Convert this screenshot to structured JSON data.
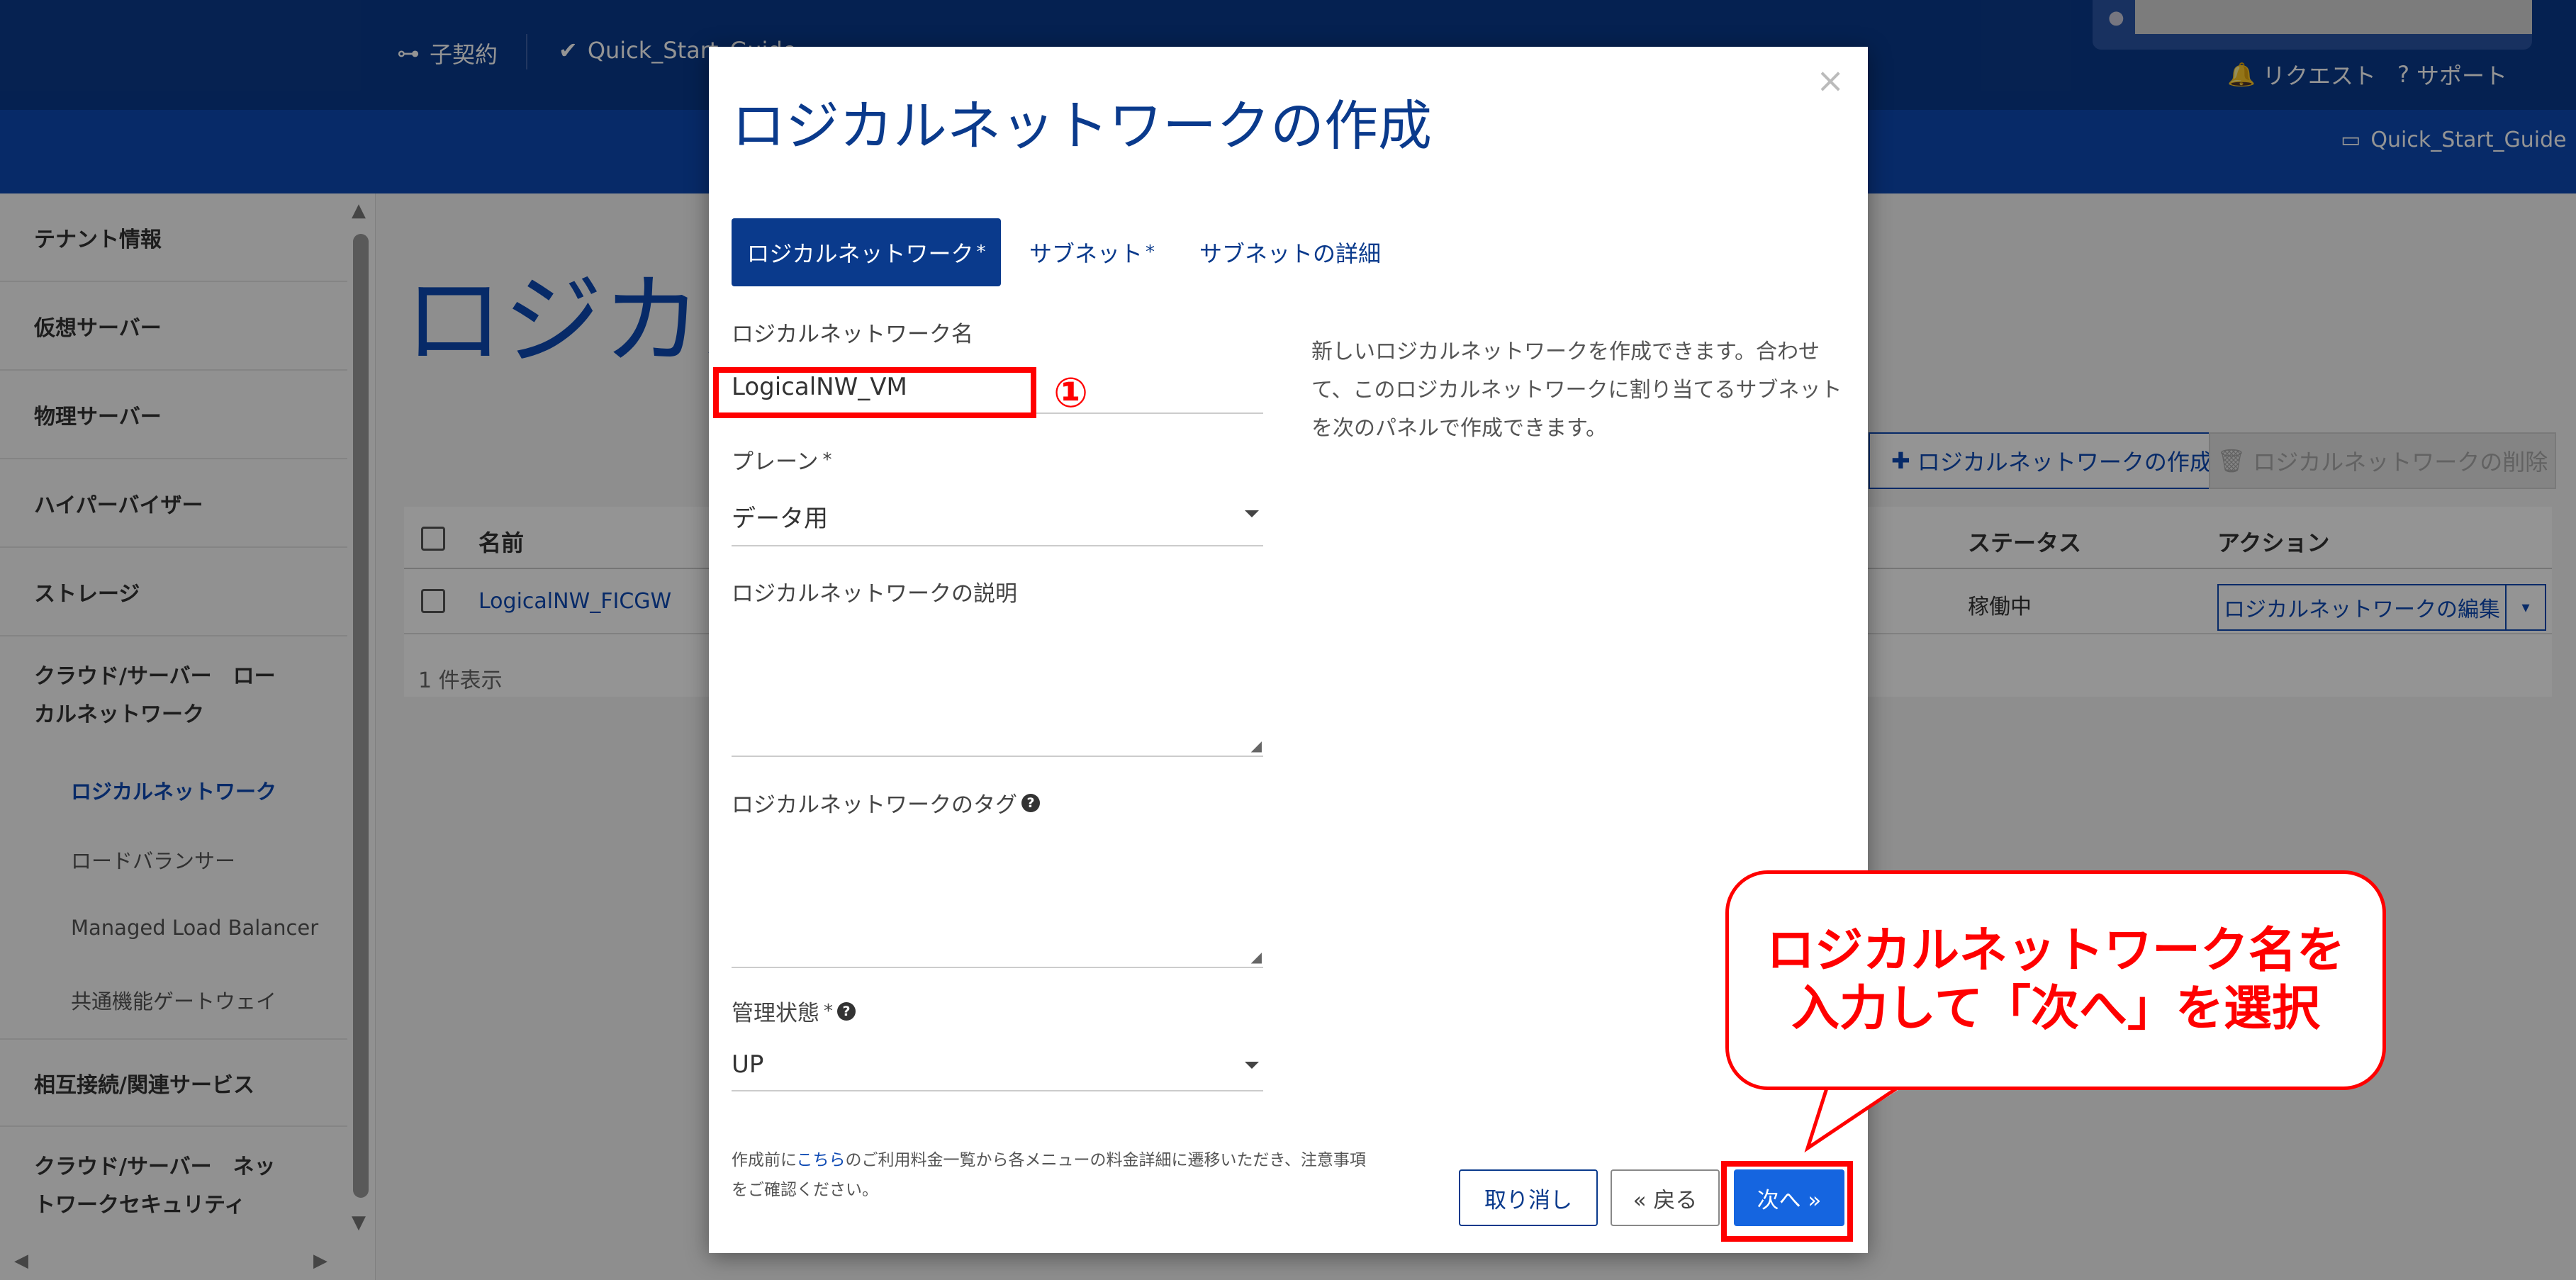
{
  "topnav": {
    "contract": "子契約",
    "project": "Quick_Start_Guide",
    "request": "リクエスト",
    "support": "サポート",
    "tenant": "Quick_Start_Guide"
  },
  "sidebar": {
    "items": [
      {
        "label": "テナント情報"
      },
      {
        "label": "仮想サーバー"
      },
      {
        "label": "物理サーバー"
      },
      {
        "label": "ハイパーバイザー"
      },
      {
        "label": "ストレージ"
      },
      {
        "label": "クラウド/サーバー　ローカルネットワーク"
      },
      {
        "label": "相互接続/関連サービス"
      },
      {
        "label": "クラウド/サーバー　ネットワークセキュリティ"
      }
    ],
    "subitems": [
      {
        "label": "ロジカルネットワーク",
        "active": true
      },
      {
        "label": "ロードバランサー"
      },
      {
        "label": "Managed Load Balancer"
      },
      {
        "label": "共通機能ゲートウェイ"
      }
    ]
  },
  "page": {
    "title": "ロジカル",
    "create_button": "ロジカルネットワークの作成",
    "delete_button": "ロジカルネットワークの削除",
    "table": {
      "headers": [
        "名前",
        "ステータス",
        "アクション"
      ],
      "rows": [
        {
          "name": "LogicalNW_FICGW",
          "status": "稼働中",
          "action": "ロジカルネットワークの編集"
        }
      ],
      "count": "1 件表示"
    }
  },
  "modal": {
    "title": "ロジカルネットワークの作成",
    "tabs": [
      {
        "label": "ロジカルネットワーク",
        "required": "*"
      },
      {
        "label": "サブネット",
        "required": "*"
      },
      {
        "label": "サブネットの詳細"
      }
    ],
    "fields": {
      "name_label": "ロジカルネットワーク名",
      "name_value": "LogicalNW_VM",
      "plane_label": "プレーン",
      "plane_required": "*",
      "plane_value": "データ用",
      "desc_label": "ロジカルネットワークの説明",
      "tag_label": "ロジカルネットワークのタグ",
      "admin_label": "管理状態",
      "admin_required": "*",
      "admin_value": "UP"
    },
    "help_text": "新しいロジカルネットワークを作成できます。合わせて、このロジカルネットワークに割り当てるサブネットを次のパネルで作成できます。",
    "footer": {
      "prefix": "作成前に",
      "link": "こちら",
      "suffix": "のご利用料金一覧から各メニューの料金詳細に遷移いただき、注意事項をご確認ください。"
    },
    "buttons": {
      "cancel": "取り消し",
      "back": "« 戻る",
      "next": "次へ »"
    }
  },
  "annotations": {
    "step_marker": "①",
    "callout": "ロジカルネットワーク名を入力して「次へ」を選択"
  }
}
